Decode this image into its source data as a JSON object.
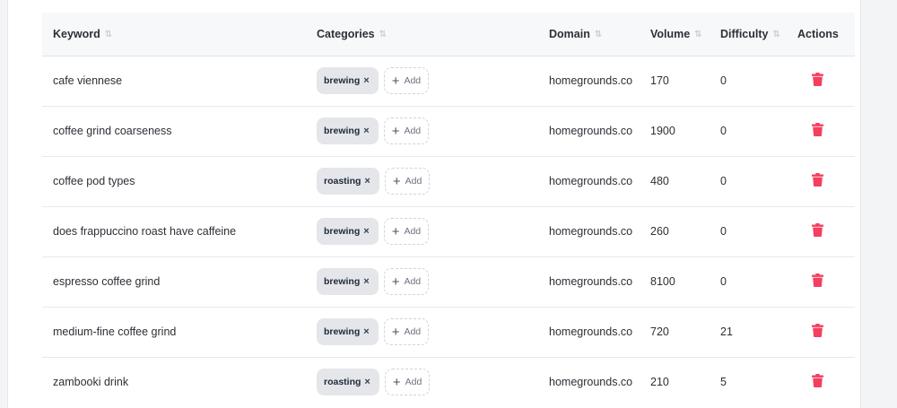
{
  "table": {
    "headers": {
      "keyword": "Keyword",
      "categories": "Categories",
      "domain": "Domain",
      "volume": "Volume",
      "difficulty": "Difficulty",
      "actions": "Actions"
    },
    "add_label": "Add",
    "remove_glyph": "×",
    "delete_color": "#f43f5e",
    "rows": [
      {
        "keyword": "cafe viennese",
        "category": "brewing",
        "domain": "homegrounds.co",
        "volume": "170",
        "difficulty": "0"
      },
      {
        "keyword": "coffee grind coarseness",
        "category": "brewing",
        "domain": "homegrounds.co",
        "volume": "1900",
        "difficulty": "0"
      },
      {
        "keyword": "coffee pod types",
        "category": "roasting",
        "domain": "homegrounds.co",
        "volume": "480",
        "difficulty": "0"
      },
      {
        "keyword": "does frappuccino roast have caffeine",
        "category": "brewing",
        "domain": "homegrounds.co",
        "volume": "260",
        "difficulty": "0"
      },
      {
        "keyword": "espresso coffee grind",
        "category": "brewing",
        "domain": "homegrounds.co",
        "volume": "8100",
        "difficulty": "0"
      },
      {
        "keyword": "medium-fine coffee grind",
        "category": "brewing",
        "domain": "homegrounds.co",
        "volume": "720",
        "difficulty": "21"
      },
      {
        "keyword": "zambooki drink",
        "category": "roasting",
        "domain": "homegrounds.co",
        "volume": "210",
        "difficulty": "5"
      }
    ]
  }
}
